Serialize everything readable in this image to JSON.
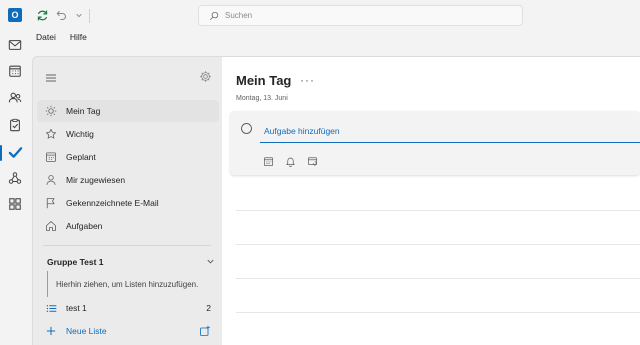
{
  "titlebar": {
    "search_placeholder": "Suchen"
  },
  "menubar": {
    "items": [
      "Datei",
      "Hilfe"
    ]
  },
  "rail": {
    "items": [
      "mail-icon",
      "calendar-icon",
      "people-icon",
      "clipboard-icon",
      "todo-check-icon",
      "network-icon",
      "apps-icon"
    ],
    "active": "todo-check-icon"
  },
  "nav": {
    "items": [
      {
        "label": "Mein Tag",
        "icon": "sun-icon"
      },
      {
        "label": "Wichtig",
        "icon": "star-icon"
      },
      {
        "label": "Geplant",
        "icon": "calendar-grid-icon"
      },
      {
        "label": "Mir zugewiesen",
        "icon": "person-icon"
      },
      {
        "label": "Gekennzeichnete E-Mail",
        "icon": "flag-icon"
      },
      {
        "label": "Aufgaben",
        "icon": "home-icon"
      }
    ],
    "group": {
      "title": "Gruppe Test 1",
      "hint": "Hierhin ziehen, um Listen hinzuzufügen."
    },
    "lists": [
      {
        "label": "test 1",
        "count": "2"
      }
    ],
    "new_list_label": "Neue Liste"
  },
  "main": {
    "title": "Mein Tag",
    "more": "···",
    "date": "Montag, 13. Juni",
    "add_task_placeholder": "Aufgabe hinzufügen"
  },
  "colors": {
    "accent": "#0f6cbd",
    "nav_bg": "#ebebeb",
    "main_bg": "#ffffff"
  }
}
